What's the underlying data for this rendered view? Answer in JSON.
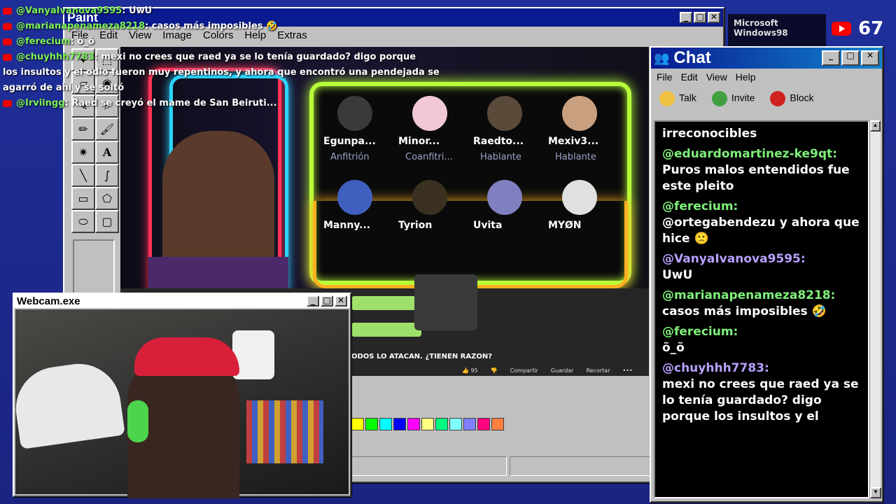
{
  "paint": {
    "title": "Paint",
    "menu": [
      "File",
      "Edit",
      "View",
      "Image",
      "Colors",
      "Help",
      "Extras"
    ]
  },
  "palette": [
    "#ffff00",
    "#00ff00",
    "#00ffff",
    "#0000ff",
    "#ff00ff",
    "#ffff80",
    "#00ff80",
    "#80ffff",
    "#8080ff",
    "#ff0080",
    "#ff8040"
  ],
  "overlay_chat": [
    {
      "user": "@VanyaIvanova9595",
      "text": ": UwU"
    },
    {
      "user": "@marianapenameza8218",
      "text": ": casos más imposibles 🤣"
    },
    {
      "user": "@ferecium",
      "text": ": õ_õ"
    },
    {
      "user": "@chuyhhh7783",
      "text": ": mexi no crees que raed ya se lo tenía guardado? digo porque"
    },
    {
      "user": "",
      "text": "los insultos y el odio fueron muy repentinos, y ahora que encontró una pendejada se"
    },
    {
      "user": "",
      "text": "agarró de ahí y se soltó"
    },
    {
      "user": "@Irviingg",
      "text": ": Raed se creyó el mame de San Beiruti..."
    }
  ],
  "participants": [
    {
      "name": "Egunpa...",
      "role": "Anfitrión",
      "color": "#3a3a3a"
    },
    {
      "name": "Minor...",
      "role": "Coanfitri...",
      "color": "#f0c8d8"
    },
    {
      "name": "Raedto...",
      "role": "Hablante",
      "color": "#5a4a3a"
    },
    {
      "name": "Mexiv3...",
      "role": "Hablante",
      "color": "#c8a080"
    },
    {
      "name": "Manny...",
      "role": "",
      "color": "#4060c0"
    },
    {
      "name": "Tyrion",
      "role": "",
      "color": "#3a3020"
    },
    {
      "name": "Uvita",
      "role": "",
      "color": "#8080c0"
    },
    {
      "name": "MYØN",
      "role": "",
      "color": "#e0e0e0"
    }
  ],
  "video": {
    "caption": "ODOS LO ATACAN. ¿TIENEN RAZON?",
    "likes": "95",
    "share": "Compartir",
    "save": "Guardar",
    "clip": "Recortar"
  },
  "chat": {
    "title": "Chat",
    "menu": [
      "File",
      "Edit",
      "View",
      "Help"
    ],
    "tools": [
      {
        "label": "Talk",
        "color": "#f0c040"
      },
      {
        "label": "Invite",
        "color": "#40a040"
      },
      {
        "label": "Block",
        "color": "#d02020"
      }
    ],
    "messages": [
      {
        "user": "",
        "text": "irreconocibles",
        "purple": false
      },
      {
        "user": "@eduardomartinez-ke9qt:",
        "text": "Puros malos entendidos fue este pleito",
        "purple": false
      },
      {
        "user": "@ferecium:",
        "text": "@ortegabendezu y ahora que hice 🙁",
        "purple": false
      },
      {
        "user": "@VanyaIvanova9595:",
        "text": "UwU",
        "purple": true
      },
      {
        "user": "@marianapenameza8218:",
        "text": "casos más imposibles 🤣",
        "purple": false
      },
      {
        "user": "@ferecium:",
        "text": "õ_õ",
        "purple": false
      },
      {
        "user": "@chuyhhh7783:",
        "text": "mexi no crees que raed ya se lo tenía guardado? digo porque los insultos y el",
        "purple": true
      }
    ]
  },
  "webcam": {
    "title": "Webcam.exe"
  },
  "viewers": "67",
  "brand": "Microsoft Windows98"
}
